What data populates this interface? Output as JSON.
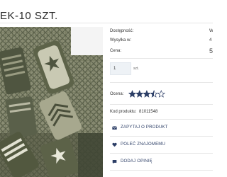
{
  "product": {
    "title": "EK-10 SZT."
  },
  "availability": {
    "label": "Dostępność:",
    "value": "W"
  },
  "shipping": {
    "label": "Wysyłka w:",
    "value": "4"
  },
  "price": {
    "label": "Cena:",
    "value": "5"
  },
  "quantity": {
    "value": "1",
    "unit": "szt."
  },
  "rating": {
    "label": "Ocena:",
    "stars_filled": 3.5,
    "stars_total": 5,
    "star_color": "#2c3e66"
  },
  "product_code": {
    "label": "Kod produktu:",
    "value": "81011548"
  },
  "actions": [
    {
      "icon": "envelope-icon",
      "label": "ZAPYTAJ O PRODUKT"
    },
    {
      "icon": "heart-icon",
      "label": "POLEĆ ZNAJOMEMU"
    },
    {
      "icon": "comment-icon",
      "label": "DODAJ OPINIĘ"
    }
  ],
  "colors": {
    "accent": "#2c3e66",
    "text": "#333333",
    "qty_bg": "#eef2f6"
  }
}
